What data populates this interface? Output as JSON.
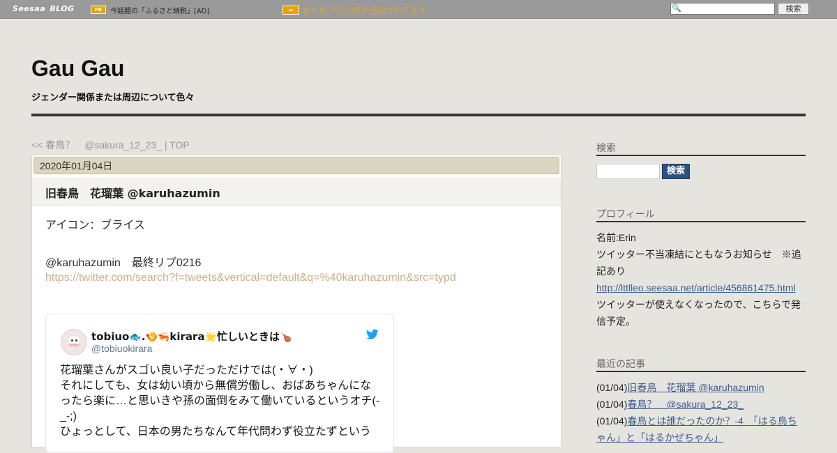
{
  "topbar": {
    "logo_brand": "Seesaa",
    "logo_blog": "BLOG",
    "pr_badge": "PR",
    "pr_text": "今話題の「ふるさと納税」[AD]",
    "arrow_badge": "➡",
    "matome_text": "まとめブログ続々追加されてます",
    "search_placeholder": "",
    "search_button": "検索"
  },
  "header": {
    "title": "Gau Gau",
    "description": "ジェンダー関係または周辺について色々"
  },
  "breadcrumb": {
    "prev": "<< 春鳥？　@sakura_12_23_",
    "separator": "|",
    "top": "TOP"
  },
  "article": {
    "date": "2020年01月04日",
    "title": "旧春鳥　花瑠葉 @karuhazumin",
    "line1": "アイコン：ブライス",
    "line2": "@karuhazumin　最終リプ0216",
    "link": "https://twitter.com/search?f=tweets&vertical=default&q=%40karuhazumin&src=typd"
  },
  "tweet": {
    "name_prefix": "tobiuo",
    "name_mid1": ".",
    "name_mid2": "kirara",
    "name_suffix": "忙しいときは",
    "handle": "@tobiuokirara",
    "text_lines": [
      "花瑠葉さんがスゴい良い子だっただけでは(・∀・)",
      "それにしても、女は幼い頃から無償労働し、おばあちゃんにな",
      "ったら楽に…と思いきや孫の面倒をみて働いているというオチ(-",
      "_-;)",
      "ひょっとして、日本の男たちなんて年代問わず役立たずという"
    ],
    "emojis": [
      "🐟",
      "🍤",
      "🦐",
      "🌟",
      "🍗"
    ]
  },
  "sidebar": {
    "search_heading": "検索",
    "search_button": "検索",
    "profile_heading": "プロフィール",
    "profile_name": "名前:Erin",
    "profile_notice": "ツイッター不当凍結にともなうお知らせ　※追記あり",
    "profile_link": "http://lttlleo.seesaa.net/article/456861475.html",
    "profile_note": "ツイッターが使えなくなったので、こちらで発信予定。",
    "recent_heading": "最近の記事",
    "recent": [
      {
        "date": "(01/04)",
        "title": "旧春鳥　花瑠葉 @karuhazumin"
      },
      {
        "date": "(01/04)",
        "title": "春鳥？　@sakura_12_23_"
      },
      {
        "date": "(01/04)",
        "title": "春鳥とは誰だったのか？-4　「はる鳥ちゃん」と「はるかぜちゃん」"
      }
    ]
  },
  "colors": {
    "background": "#e6e4df",
    "topbar": "#9a9a9a",
    "accent_orange": "#e8a300",
    "link_blue": "#3b5d8f",
    "twitter_blue": "#1da1f2"
  }
}
